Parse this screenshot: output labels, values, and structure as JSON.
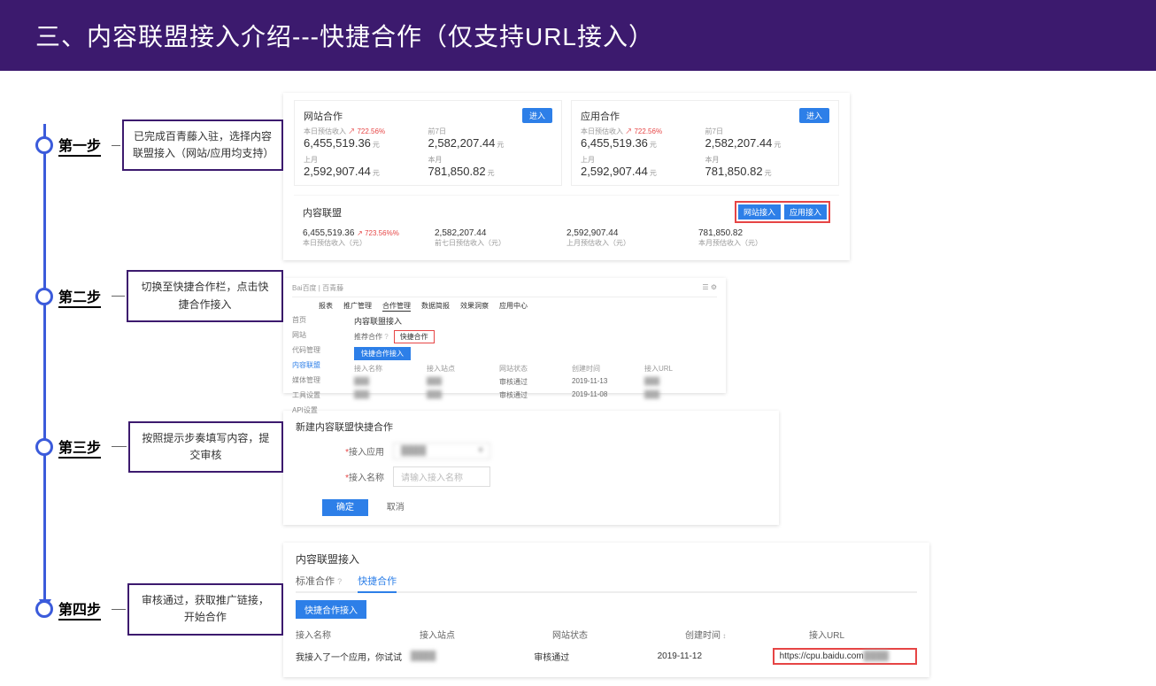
{
  "header_title": "三、内容联盟接入介绍---快捷合作（仅支持URL接入）",
  "steps": {
    "s1": {
      "label": "第一步",
      "desc": "已完成百青藤入驻，选择内容联盟接入（网站/应用均支持）"
    },
    "s2": {
      "label": "第二步",
      "desc": "切换至快捷合作栏，点击快捷合作接入"
    },
    "s3": {
      "label": "第三步",
      "desc": "按照提示步奏填写内容，提交审核"
    },
    "s4": {
      "label": "第四步",
      "desc": "审核通过，获取推广链接，开始合作"
    }
  },
  "panel1": {
    "card1_title": "网站合作",
    "card2_title": "应用合作",
    "enter_btn": "进入",
    "pct_text": "722.56%",
    "val_a": "6,455,519.36",
    "val_b": "2,582,207.44",
    "lbl_a": "本日预估收入",
    "lbl_b": "前7日",
    "val_c": "2,592,907.44",
    "val_d": "781,850.82",
    "lbl_c": "上月",
    "lbl_d": "本月",
    "unit": "元",
    "bottom_title": "内容联盟",
    "btn_web": "网站接入",
    "btn_app": "应用接入",
    "b1_val": "6,455,519.36",
    "b1_pct": "723.56%%",
    "b1_lbl": "本日预估收入（元）",
    "b2_val": "2,582,207.44",
    "b2_lbl": "前七日预估收入（元）",
    "b3_val": "2,592,907.44",
    "b3_lbl": "上月预估收入（元）",
    "b4_val": "781,850.82",
    "b4_lbl": "本月预估收入（元）"
  },
  "panel2": {
    "logo": "Bai百度 | 百青藤",
    "nav": [
      "报表",
      "推广管理",
      "合作管理",
      "数据简报",
      "效果洞察",
      "应用中心"
    ],
    "side": [
      "首页",
      "网站",
      "代码管理",
      "内容联盟",
      "媒体管理",
      "工具设置",
      "API设置"
    ],
    "sub_title": "内容联盟接入",
    "tab1": "推荐合作",
    "tab_q": "?",
    "tab2": "快捷合作",
    "new_btn": "快捷合作接入",
    "cols": [
      "接入名称",
      "接入站点",
      "网站状态",
      "创建时间",
      "接入URL"
    ],
    "row_date1": "2019-11-13",
    "row_date2": "2019-11-08"
  },
  "panel3": {
    "title": "新建内容联盟快捷合作",
    "lbl_app": "接入应用",
    "lbl_name": "接入名称",
    "select_placeholder": " ",
    "input_placeholder": "请输入接入名称",
    "confirm": "确定",
    "cancel": "取消",
    "star": "*"
  },
  "panel4": {
    "title": "内容联盟接入",
    "tab_std": "标准合作",
    "tab_q": "?",
    "tab_quick": "快捷合作",
    "new_btn": "快捷合作接入",
    "cols": {
      "c1": "接入名称",
      "c2": "接入站点",
      "c3": "网站状态",
      "c4": "创建时间",
      "c5": "接入URL"
    },
    "row": {
      "name": "我接入了一个应用，你试试",
      "status": "审核通过",
      "date": "2019-11-12",
      "url": "https://cpu.baidu.com"
    }
  }
}
